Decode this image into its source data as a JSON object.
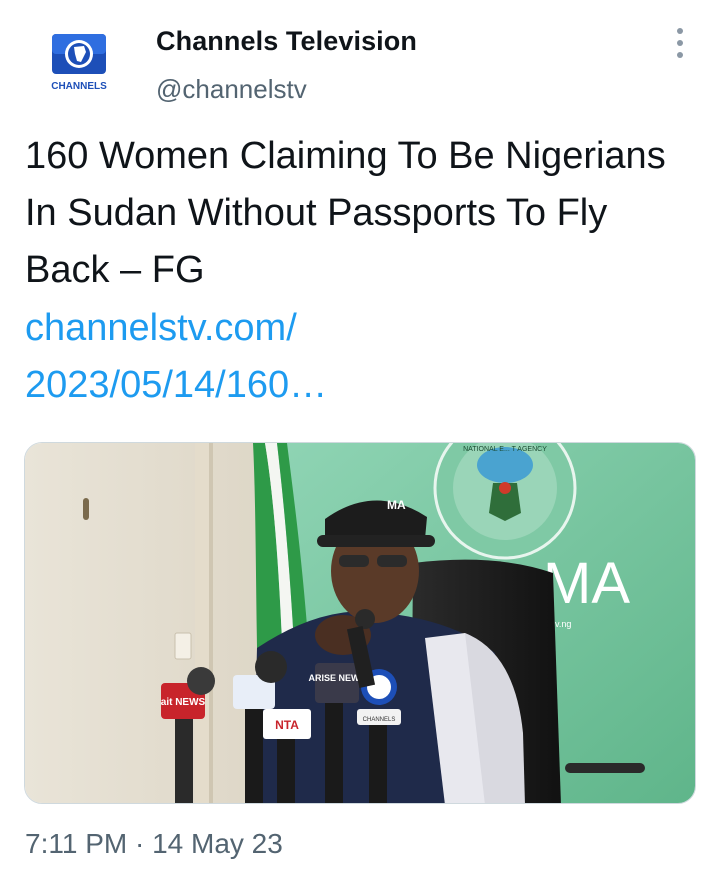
{
  "author": {
    "name": "Channels Television",
    "handle": "@channelstv",
    "avatar_label": "CHANNELS"
  },
  "tweet": {
    "text": "160 Women Claiming To Be Nigerians In Sudan Without Passports To Fly Back – FG",
    "link_line1": "channelstv.com/",
    "link_line2": "2023/05/14/160…",
    "timestamp": "7:11 PM · 14 May 23"
  },
  "media": {
    "sign_text": "MA",
    "seal_text": "NATIONAL E... T AGENCY",
    "mic_label_arise": "ARISE NEWS",
    "mic_label_ait": "ait NEWS",
    "mic_label_nta": "NTA",
    "mic_label_channels": "CHANNELS",
    "cap_text": "MA",
    "web_text": "v.ng"
  },
  "colors": {
    "link": "#1d9bf0",
    "secondary_text": "#536471",
    "wall_green": "#6fc29a",
    "flag_green": "#2e9a48"
  },
  "icons": {
    "more": "more-options-icon",
    "avatar": "channels-logo-icon"
  }
}
